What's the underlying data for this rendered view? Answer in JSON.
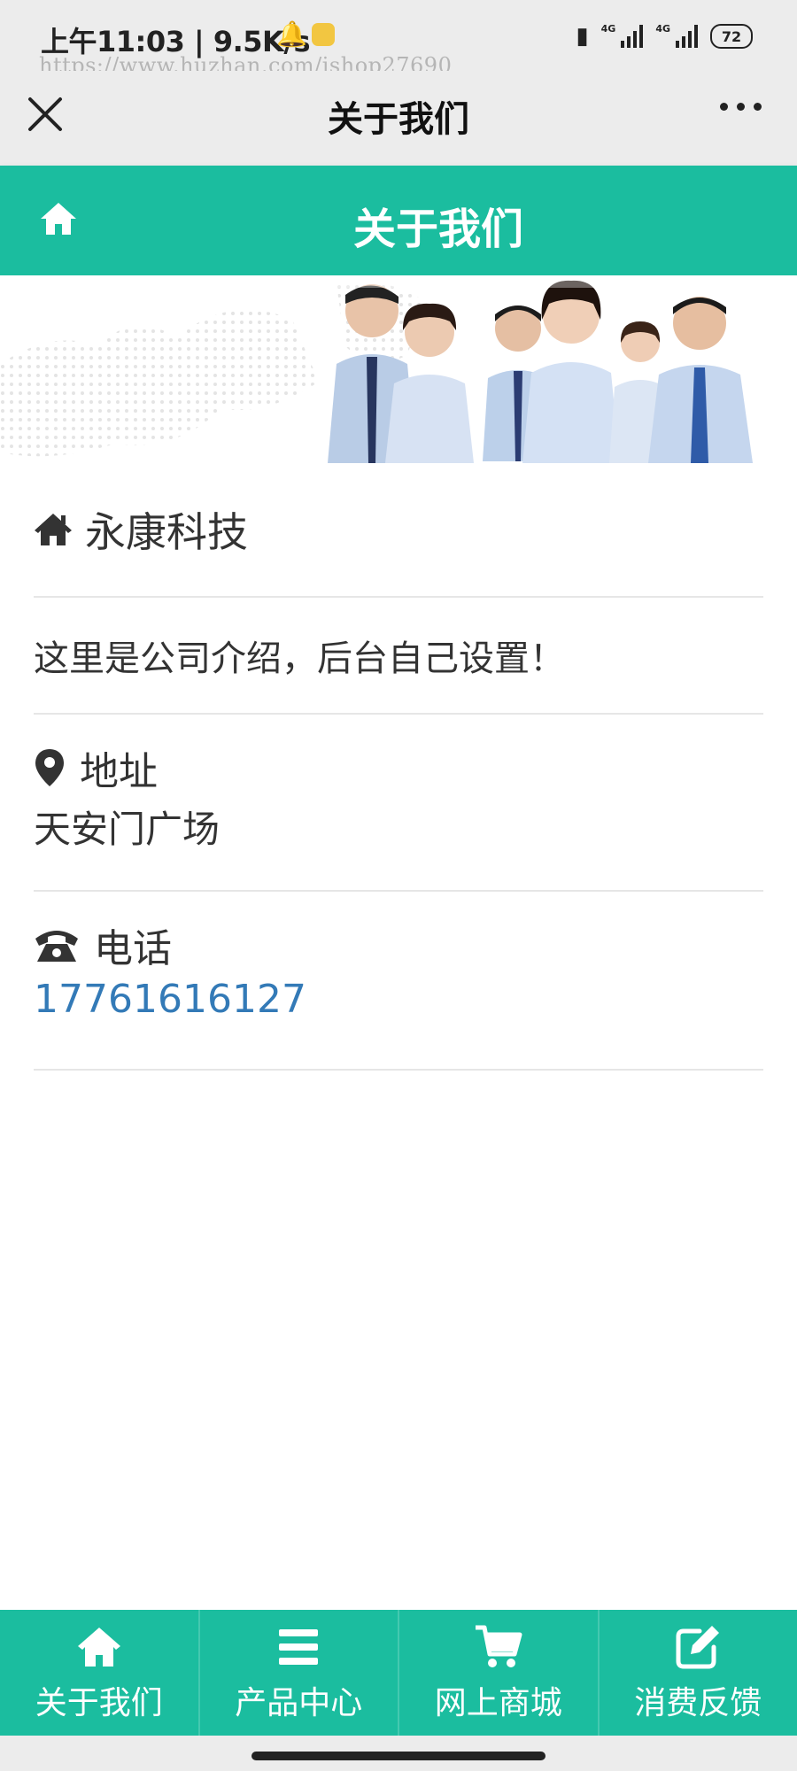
{
  "status": {
    "time": "上午11:03 | 9.5K/s",
    "watermark": "https://www.huzhan.com/ishop27690",
    "network_1": "4G",
    "network_2": "4G",
    "battery": "72",
    "icons": [
      "bell-icon",
      "app-notification-icon",
      "sim-icon",
      "signal-icon",
      "battery-icon"
    ]
  },
  "navbar": {
    "title": "关于我们",
    "close_icon": "close-icon",
    "more_icon": "more-icon"
  },
  "header": {
    "title": "关于我们",
    "home_icon": "home-icon"
  },
  "banner": {
    "image": "team-photo-banner"
  },
  "company": {
    "icon": "home-icon",
    "name": "永康科技"
  },
  "intro": {
    "text": "这里是公司介绍，后台自己设置！"
  },
  "address": {
    "icon": "map-marker-icon",
    "label": "地址",
    "value": "天安门广场"
  },
  "phone": {
    "icon": "phone-icon",
    "label": "电话",
    "value": "17761616127"
  },
  "tabbar": {
    "items": [
      {
        "label": "关于我们",
        "icon": "home-icon"
      },
      {
        "label": "产品中心",
        "icon": "list-icon"
      },
      {
        "label": "网上商城",
        "icon": "cart-icon"
      },
      {
        "label": "消费反馈",
        "icon": "edit-icon"
      }
    ]
  },
  "colors": {
    "accent": "#1bbd9f",
    "link": "#337ab7",
    "text": "#333333",
    "chrome": "#ececec"
  }
}
